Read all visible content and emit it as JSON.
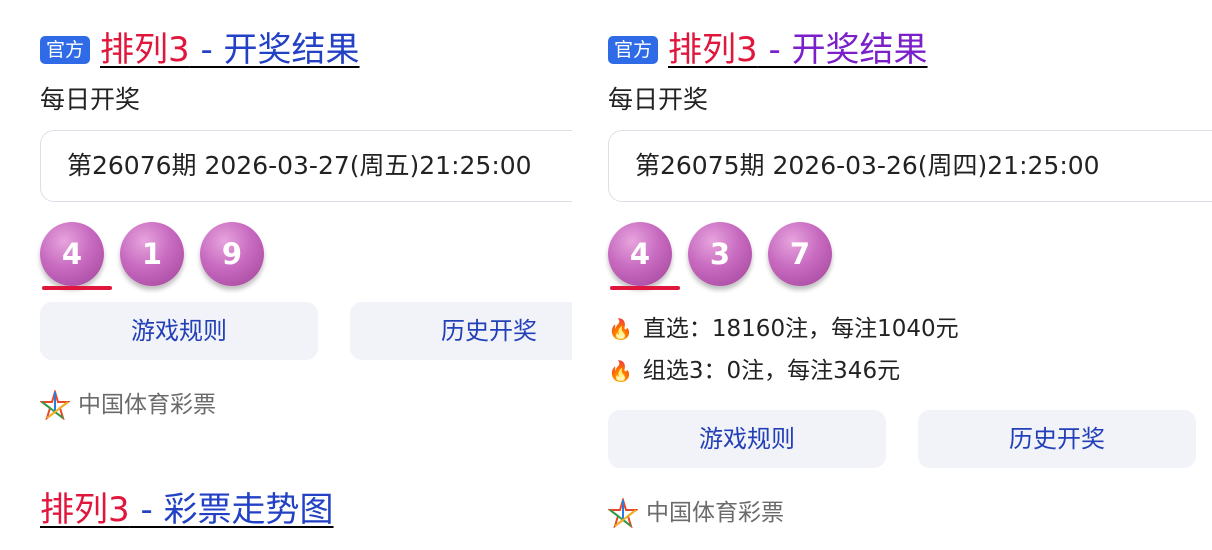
{
  "left": {
    "badge": "官方",
    "title_keyword": "排列3",
    "title_rest": " - 开奖结果",
    "subtitle": "每日开奖",
    "draw_info": "第26076期 2026-03-27(周五)21:25:00",
    "balls": [
      "4",
      "1",
      "9"
    ],
    "buttons": {
      "rules": "游戏规则",
      "history": "历史开奖"
    },
    "source": "中国体育彩票",
    "second_result": {
      "title_keyword": "排列3",
      "title_rest": " - 彩票走势图"
    }
  },
  "right": {
    "badge": "官方",
    "title_keyword": "排列3",
    "title_rest": " - 开奖结果",
    "subtitle": "每日开奖",
    "draw_info": "第26075期 2026-03-26(周四)21:25:00",
    "balls": [
      "4",
      "3",
      "7"
    ],
    "prizes": [
      {
        "icon": "fire-icon",
        "text": "直选：18160注，每注1040元"
      },
      {
        "icon": "fire-icon",
        "text": "组选3：0注，每注346元"
      }
    ],
    "buttons": {
      "rules": "游戏规则",
      "history": "历史开奖"
    },
    "source": "中国体育彩票"
  },
  "colors": {
    "keyword_red": "#e0163c",
    "link_blue": "#2241c4",
    "visited_purple": "#7a1fc9",
    "badge_blue": "#2f6be6",
    "ball_purple": "#b857ad",
    "button_bg": "#f1f3f8"
  }
}
